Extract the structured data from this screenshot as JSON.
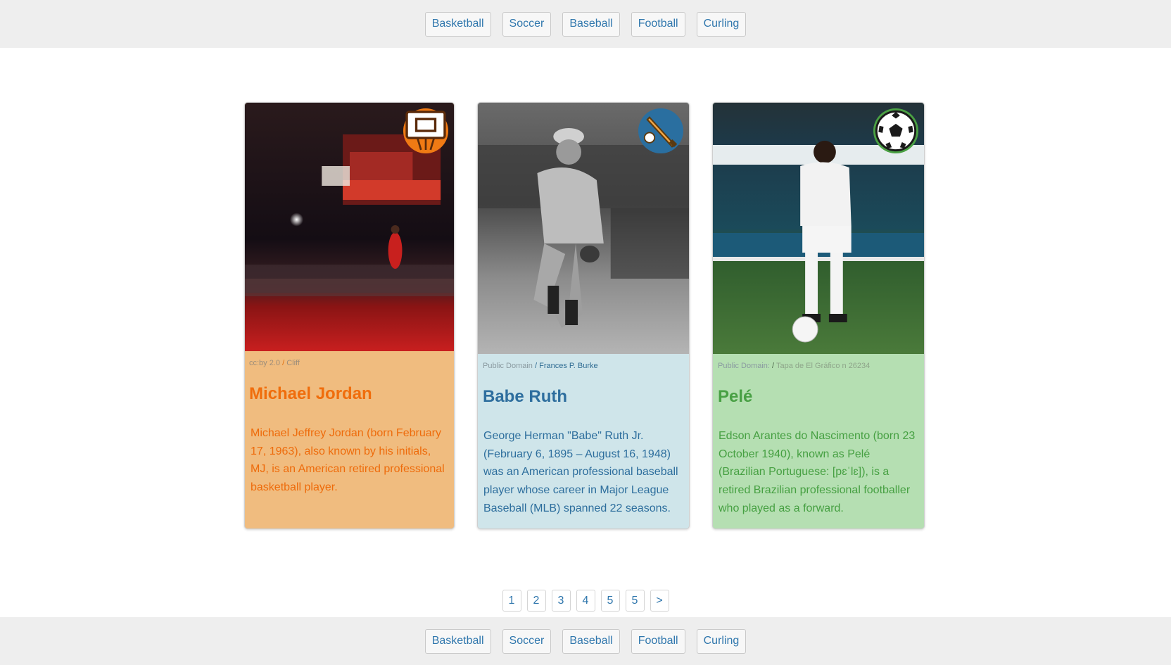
{
  "nav": {
    "items": [
      {
        "label": "Basketball"
      },
      {
        "label": "Soccer"
      },
      {
        "label": "Baseball"
      },
      {
        "label": "Football"
      },
      {
        "label": "Curling"
      }
    ]
  },
  "cards": [
    {
      "sport_icon": "basketball-hoop-icon",
      "credit_license": "cc:by 2.0",
      "credit_sep": " / ",
      "credit_author": "Cliff",
      "name": "Michael Jordan",
      "bio": "Michael Jeffrey Jordan (born February 17, 1963), also known by his initials, MJ, is an American retired professional basketball player.",
      "accent": "#f06d0c",
      "background": "#f0bc7f"
    },
    {
      "sport_icon": "baseball-bat-icon",
      "credit_license": "Public Domain",
      "credit_sep": " / ",
      "credit_author": "Frances P. Burke",
      "name": "Babe Ruth",
      "bio": "George Herman \"Babe\" Ruth Jr. (February 6, 1895 – August 16, 1948) was an American professional baseball player whose career in Major League Baseball (MLB) spanned 22 seasons.",
      "accent": "#2e6e9e",
      "background": "#cfe5ea"
    },
    {
      "sport_icon": "soccer-ball-icon",
      "credit_license": "Public Domain:",
      "credit_sep": " / ",
      "credit_author": "Tapa de El Gráfico n 26234",
      "name": "Pelé",
      "bio": "Edson Arantes do Nascimento (born 23 October 1940), known as Pelé (Brazilian Portuguese: [pɛˈlɛ]), is a retired Brazilian professional footballer who played as a forward.",
      "accent": "#48a044",
      "background": "#b5dfb2"
    }
  ],
  "pagination": {
    "pages": [
      "1",
      "2",
      "3",
      "4",
      "5",
      "5"
    ],
    "next_label": ">"
  }
}
